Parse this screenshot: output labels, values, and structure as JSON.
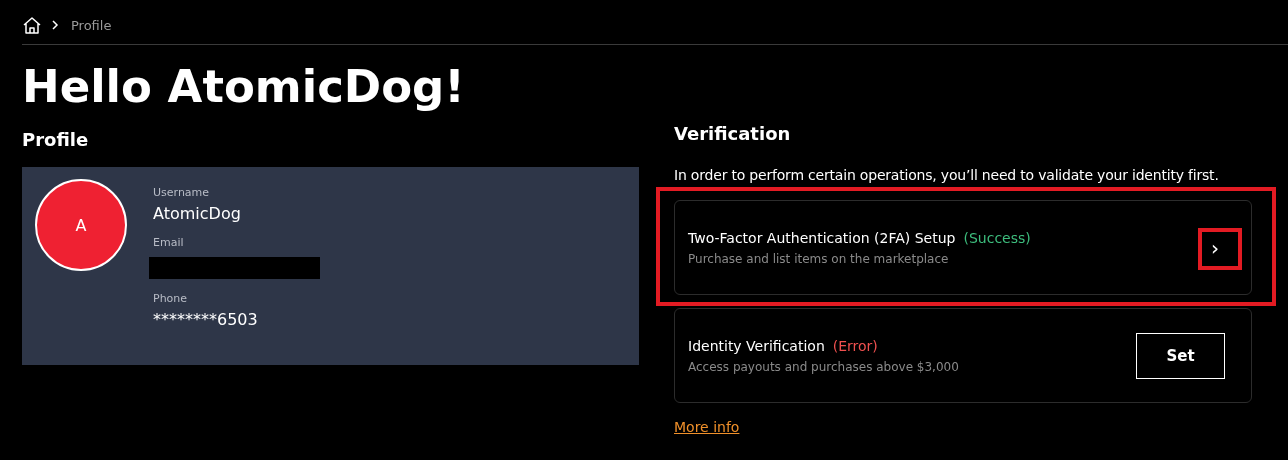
{
  "breadcrumb": {
    "current": "Profile"
  },
  "title": "Hello AtomicDog!",
  "profile": {
    "heading": "Profile",
    "avatar_letter": "A",
    "fields": [
      {
        "label": "Username",
        "value": "AtomicDog",
        "redacted": false
      },
      {
        "label": "Email",
        "redacted": true
      },
      {
        "label": "Phone",
        "value": "********6503",
        "redacted": false
      }
    ]
  },
  "verification": {
    "heading": "Verification",
    "description": "In order to perform certain operations, you’ll need to validate your identity first.",
    "items": [
      {
        "title": "Two-Factor Authentication (2FA) Setup",
        "status": "(Success)",
        "color": "#3dbd7d",
        "subtitle": "Purchase and list items on the marketplace",
        "action": {
          "kind": "chevron",
          "label": "›",
          "highlighted": true
        },
        "highlighted": true
      },
      {
        "title": "Identity Verification",
        "status": "(Error)",
        "color": "#f0504f",
        "subtitle": "Access payouts and purchases above $3,000",
        "action": {
          "kind": "button",
          "label": "Set",
          "highlighted": false
        },
        "highlighted": false
      }
    ],
    "link": "More info"
  }
}
